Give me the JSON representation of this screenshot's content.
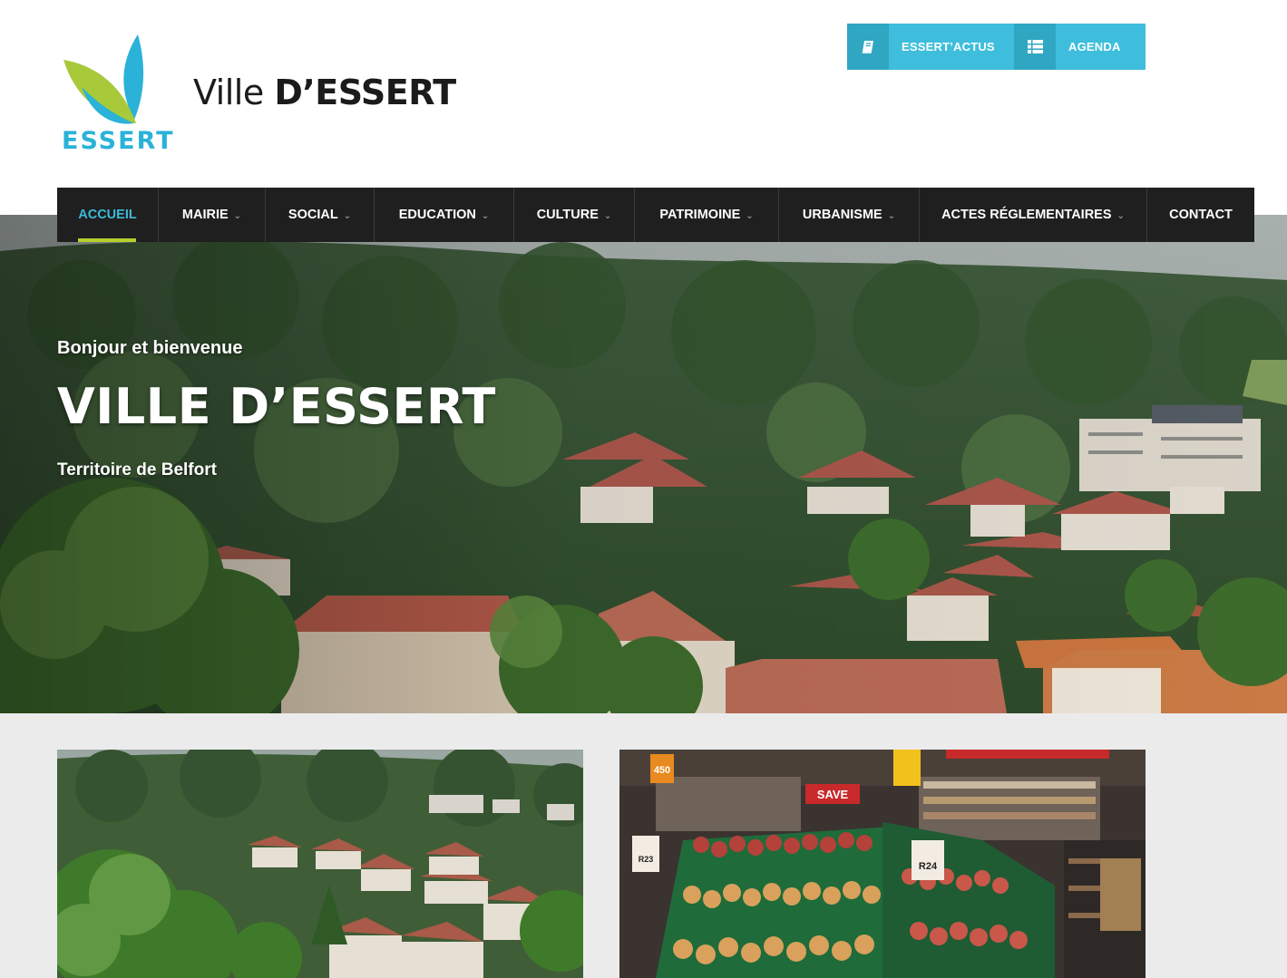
{
  "header": {
    "logo_text": "ESSERT",
    "title_prefix": "Ville",
    "title_bold": "D’ESSERT",
    "buttons": [
      {
        "label": "ESSERT’ACTUS",
        "icon": "book-icon"
      },
      {
        "label": "AGENDA",
        "icon": "list-icon"
      }
    ]
  },
  "nav": {
    "items": [
      {
        "label": "ACCUEIL",
        "active": true,
        "has_dropdown": false
      },
      {
        "label": "MAIRIE",
        "active": false,
        "has_dropdown": true
      },
      {
        "label": "SOCIAL",
        "active": false,
        "has_dropdown": true
      },
      {
        "label": "EDUCATION",
        "active": false,
        "has_dropdown": true
      },
      {
        "label": "CULTURE",
        "active": false,
        "has_dropdown": true
      },
      {
        "label": "PATRIMOINE",
        "active": false,
        "has_dropdown": true
      },
      {
        "label": "URBANISME",
        "active": false,
        "has_dropdown": true
      },
      {
        "label": "ACTES RÉGLEMENTAIRES",
        "active": false,
        "has_dropdown": true
      },
      {
        "label": "CONTACT",
        "active": false,
        "has_dropdown": false
      }
    ]
  },
  "hero": {
    "kicker": "Bonjour et bienvenue",
    "title": "VILLE D’ESSERT",
    "subtitle": "Territoire de Belfort"
  },
  "cards": {
    "card1": {
      "image": "village-photo"
    },
    "card2": {
      "image": "supermarket-photo",
      "sign_1": "450",
      "sign_2": "SAVE",
      "price_1": "R23",
      "price_2": "R24"
    }
  },
  "colors": {
    "accent_blue": "#3ebedc",
    "accent_blue_dark": "#2fa6c2",
    "accent_green": "#b5cf2c",
    "nav_bg": "#1f1f1f",
    "section_bg": "#ebebeb"
  }
}
